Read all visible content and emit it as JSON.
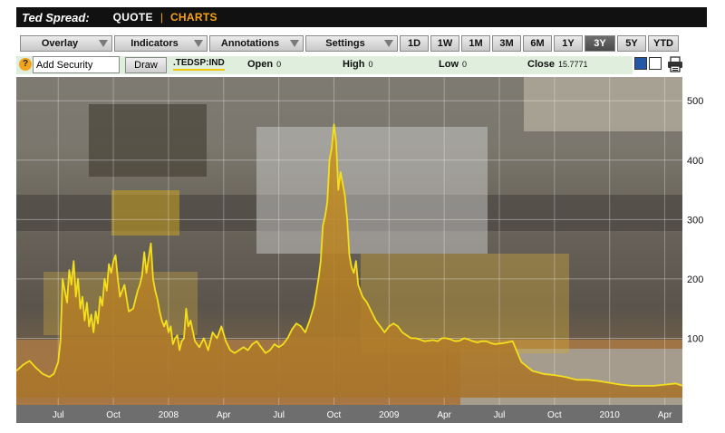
{
  "header": {
    "title": "Ted Spread:",
    "nav": [
      "QUOTE",
      "CHARTS"
    ],
    "separator": "|"
  },
  "toolbar": {
    "menus": [
      "Overlay",
      "Indicators",
      "Annotations",
      "Settings"
    ],
    "ranges": [
      "1D",
      "1W",
      "1M",
      "3M",
      "6M",
      "1Y",
      "3Y",
      "5Y",
      "YTD"
    ],
    "active_range": "3Y"
  },
  "infobar": {
    "add_security_value": "Add Security",
    "draw_label": "Draw",
    "ticker": ".TEDSP:IND",
    "open_label": "Open",
    "open_value": "0",
    "high_label": "High",
    "high_value": "0",
    "low_label": "Low",
    "low_value": "0",
    "close_label": "Close",
    "close_value": "15.7771"
  },
  "colors": {
    "accent": "#f5a21b",
    "line": "#f3df1c",
    "area": "#c9921c",
    "active_button": "#555555",
    "infobar": "#dfeedd"
  },
  "icons": [
    "help-icon",
    "single-view-icon",
    "dual-view-icon",
    "print-icon"
  ],
  "chart_data": {
    "type": "area",
    "title": "",
    "xlabel": "",
    "ylabel": "",
    "ylim": [
      0,
      540
    ],
    "yticks": [
      100,
      200,
      300,
      400,
      500
    ],
    "y_axis_side": "right",
    "grid": true,
    "background": "photo of open-pit coal mining equipment (excavators and haul trucks)",
    "x_tick_labels": [
      {
        "label": "Jul",
        "t": 2007.5
      },
      {
        "label": "Oct",
        "t": 2007.75
      },
      {
        "label": "2008",
        "t": 2008.0
      },
      {
        "label": "Apr",
        "t": 2008.25
      },
      {
        "label": "Jul",
        "t": 2008.5
      },
      {
        "label": "Oct",
        "t": 2008.75
      },
      {
        "label": "2009",
        "t": 2009.0
      },
      {
        "label": "Apr",
        "t": 2009.25
      },
      {
        "label": "Jul",
        "t": 2009.5
      },
      {
        "label": "Oct",
        "t": 2009.75
      },
      {
        "label": "2010",
        "t": 2010.0
      },
      {
        "label": "Apr",
        "t": 2010.25
      }
    ],
    "series": [
      {
        "t": [
          2007.31,
          2007.34,
          2007.37,
          2007.4,
          2007.43,
          2007.46,
          2007.48,
          2007.5,
          2007.51,
          2007.52,
          2007.53,
          2007.54,
          2007.55,
          2007.56,
          2007.57,
          2007.58,
          2007.59,
          2007.6,
          2007.61,
          2007.62,
          2007.63,
          2007.64,
          2007.65,
          2007.66,
          2007.67,
          2007.68,
          2007.69,
          2007.7,
          2007.71,
          2007.72,
          2007.73,
          2007.74,
          2007.75,
          2007.76,
          2007.77,
          2007.78,
          2007.8,
          2007.82,
          2007.84,
          2007.86,
          2007.87,
          2007.88,
          2007.89,
          2007.9,
          2007.91,
          2007.92,
          2007.93,
          2007.94,
          2007.95,
          2007.96,
          2007.97,
          2007.98,
          2007.99,
          2008.0,
          2008.01,
          2008.02,
          2008.03,
          2008.04,
          2008.05,
          2008.06,
          2008.07,
          2008.08,
          2008.09,
          2008.1,
          2008.12,
          2008.14,
          2008.16,
          2008.17,
          2008.18,
          2008.19,
          2008.2,
          2008.22,
          2008.24,
          2008.26,
          2008.28,
          2008.3,
          2008.32,
          2008.34,
          2008.36,
          2008.38,
          2008.4,
          2008.42,
          2008.44,
          2008.46,
          2008.48,
          2008.5,
          2008.52,
          2008.54,
          2008.56,
          2008.58,
          2008.6,
          2008.62,
          2008.64,
          2008.66,
          2008.68,
          2008.69,
          2008.7,
          2008.71,
          2008.72,
          2008.73,
          2008.74,
          2008.75,
          2008.76,
          2008.77,
          2008.78,
          2008.79,
          2008.8,
          2008.81,
          2008.82,
          2008.83,
          2008.84,
          2008.85,
          2008.86,
          2008.88,
          2008.9,
          2008.92,
          2008.94,
          2008.96,
          2008.98,
          2009.0,
          2009.02,
          2009.04,
          2009.06,
          2009.08,
          2009.1,
          2009.12,
          2009.14,
          2009.16,
          2009.18,
          2009.2,
          2009.22,
          2009.24,
          2009.26,
          2009.28,
          2009.3,
          2009.32,
          2009.34,
          2009.36,
          2009.38,
          2009.4,
          2009.42,
          2009.44,
          2009.46,
          2009.48,
          2009.52,
          2009.56,
          2009.6,
          2009.65,
          2009.7,
          2009.75,
          2009.8,
          2009.85,
          2009.9,
          2009.95,
          2010.0,
          2010.05,
          2010.1,
          2010.15,
          2010.2,
          2010.25,
          2010.3,
          2010.33
        ],
        "values": [
          45,
          55,
          62,
          50,
          40,
          35,
          40,
          60,
          95,
          200,
          180,
          160,
          215,
          190,
          230,
          170,
          200,
          150,
          170,
          130,
          160,
          120,
          140,
          110,
          145,
          125,
          170,
          155,
          200,
          180,
          225,
          210,
          230,
          240,
          200,
          170,
          190,
          145,
          150,
          180,
          190,
          205,
          245,
          210,
          235,
          260,
          200,
          180,
          165,
          145,
          130,
          120,
          130,
          110,
          120,
          90,
          100,
          105,
          80,
          95,
          100,
          150,
          120,
          130,
          95,
          85,
          100,
          90,
          80,
          95,
          110,
          100,
          120,
          95,
          80,
          75,
          80,
          85,
          80,
          90,
          95,
          85,
          75,
          80,
          90,
          85,
          90,
          100,
          115,
          125,
          120,
          110,
          130,
          155,
          200,
          230,
          290,
          305,
          330,
          400,
          420,
          460,
          430,
          350,
          380,
          360,
          340,
          300,
          240,
          220,
          210,
          230,
          190,
          170,
          160,
          145,
          130,
          120,
          110,
          120,
          125,
          120,
          110,
          105,
          100,
          100,
          98,
          95,
          96,
          97,
          95,
          100,
          100,
          98,
          95,
          96,
          100,
          98,
          95,
          93,
          95,
          95,
          92,
          90,
          92,
          95,
          60,
          45,
          40,
          38,
          35,
          30,
          30,
          28,
          25,
          22,
          20,
          20,
          20,
          22,
          24,
          20,
          22,
          30,
          28
        ]
      }
    ]
  }
}
